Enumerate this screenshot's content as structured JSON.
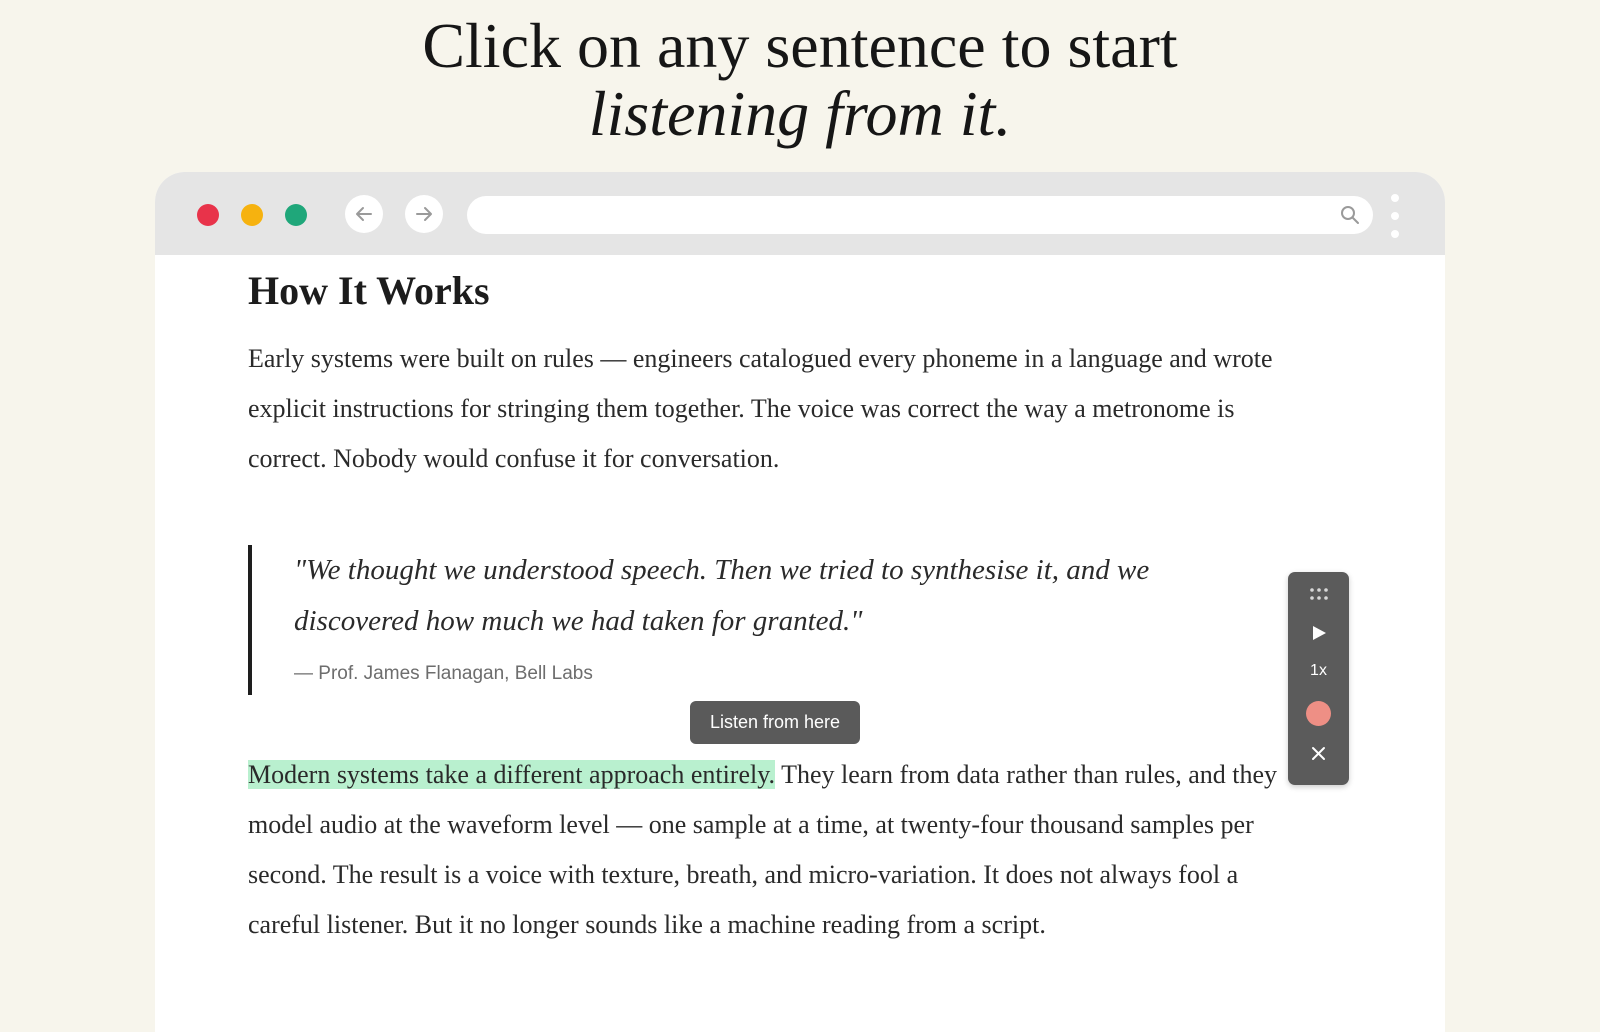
{
  "headline": {
    "line1": "Click on any sentence to start",
    "line2": "listening from it."
  },
  "browser": {
    "traffic_lights": {
      "close": "#e8334a",
      "minimize": "#f6b20f",
      "maximize": "#1fa77a"
    },
    "icons": {
      "back": "arrow-left-icon",
      "forward": "arrow-right-icon",
      "search": "search-icon",
      "menu": "kebab-menu-icon"
    },
    "address_value": ""
  },
  "article": {
    "heading": "How It Works",
    "paragraph1": "Early systems were built on rules — engineers catalogued every phoneme in a language and wrote explicit instructions for stringing them together. The voice was correct the way a metronome is correct. Nobody would confuse it for conversation.",
    "quote": "\"We thought we understood speech. Then we tried to synthesise it, and we discovered how much we had taken for granted.\"",
    "citation": "— Prof. James Flanagan, Bell Labs",
    "paragraph2_highlight": "Modern systems take a different approach entirely.",
    "paragraph2_rest": " They learn from data rather than rules, and they model audio at the waveform level — one sample at a time, at twenty-four thousand samples per second. The result is a voice with texture, breath, and micro-variation. It does not always fool a careful listener. But it no longer sounds like a machine reading from a script.",
    "highlight_color": "#b9f0cf"
  },
  "tooltip": {
    "label": "Listen from here"
  },
  "player": {
    "speed": "1x",
    "icons": {
      "drag": "drag-grip-icon",
      "play": "play-icon",
      "record": "record-icon",
      "close": "close-icon"
    },
    "record_color": "#ee8f85"
  }
}
